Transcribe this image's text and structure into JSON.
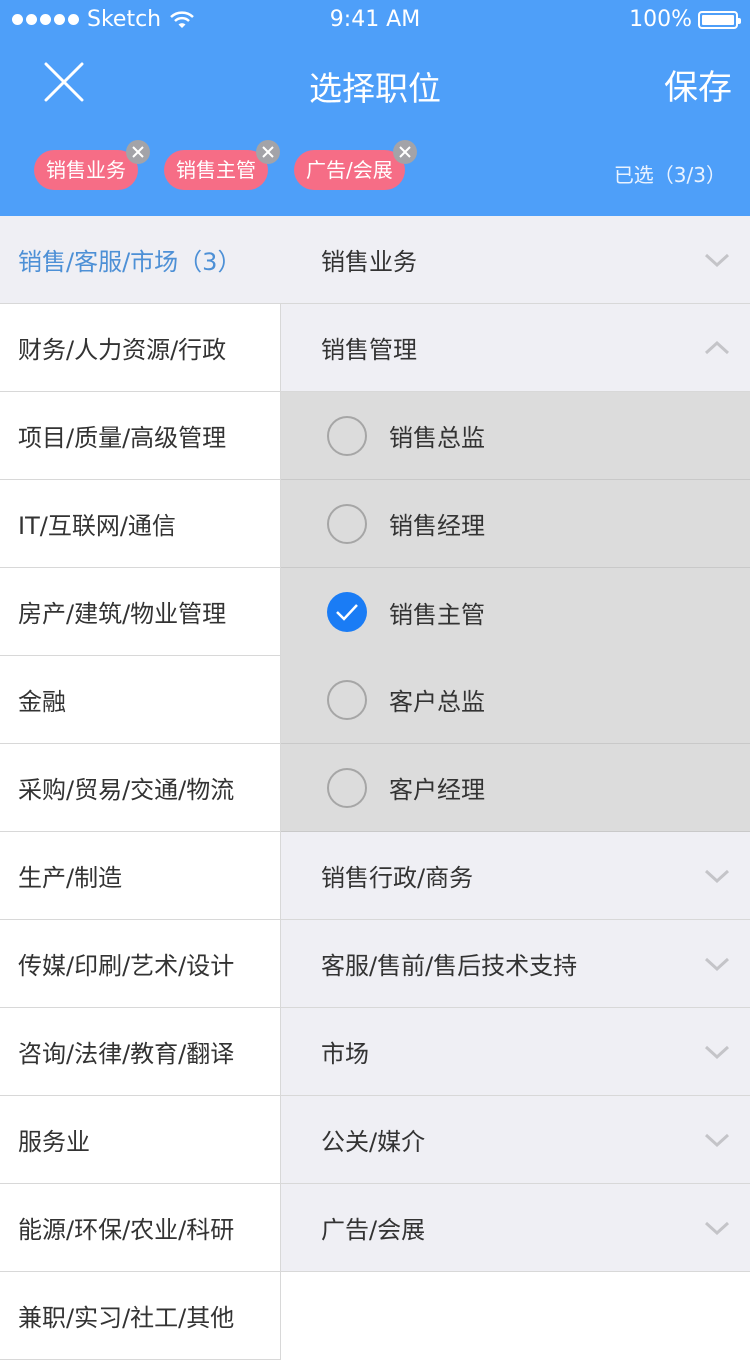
{
  "status": {
    "carrier": "Sketch",
    "time": "9:41 AM",
    "battery": "100%"
  },
  "nav": {
    "title": "选择职位",
    "save_label": "保存"
  },
  "selected": {
    "chips": [
      "销售业务",
      "销售主管",
      "广告/会展"
    ],
    "count_text": "已选（3/3）"
  },
  "categories": [
    "销售/客服/市场（3）",
    "财务/人力资源/行政",
    "项目/质量/高级管理",
    "IT/互联网/通信",
    "房产/建筑/物业管理",
    "金融",
    "采购/贸易/交通/物流",
    "生产/制造",
    "传媒/印刷/艺术/设计",
    "咨询/法律/教育/翻译",
    "服务业",
    "能源/环保/农业/科研",
    "兼职/实习/社工/其他"
  ],
  "subcategories": {
    "s0": "销售业务",
    "s1": "销售管理",
    "options": [
      "销售总监",
      "销售经理",
      "销售主管",
      "客户总监",
      "客户经理"
    ],
    "checked_option": "销售主管",
    "s2": "销售行政/商务",
    "s3": "客服/售前/售后技术支持",
    "s4": "市场",
    "s5": "公关/媒介",
    "s6": "广告/会展"
  },
  "colors": {
    "header": "#4e9ff9",
    "chip": "#f66d86",
    "accent": "#1a7cf5",
    "active_text": "#4d90d6"
  }
}
